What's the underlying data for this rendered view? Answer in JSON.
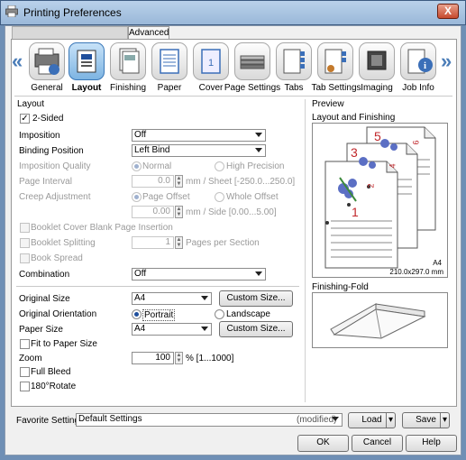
{
  "window": {
    "title": "Printing Preferences",
    "close_label": "X"
  },
  "tabs": {
    "advanced_label": "Advanced"
  },
  "nav": {
    "left_arrow": "«",
    "right_arrow": "»",
    "items": [
      {
        "label": "General",
        "icon": "general-icon"
      },
      {
        "label": "Layout",
        "icon": "layout-icon",
        "active": true
      },
      {
        "label": "Finishing",
        "icon": "finishing-icon"
      },
      {
        "label": "Paper",
        "icon": "paper-icon"
      },
      {
        "label": "Cover",
        "icon": "cover-icon"
      },
      {
        "label": "Page Settings",
        "icon": "page-settings-icon"
      },
      {
        "label": "Tabs",
        "icon": "tabs-icon"
      },
      {
        "label": "Tab Settings",
        "icon": "tab-settings-icon"
      },
      {
        "label": "Imaging",
        "icon": "imaging-icon"
      },
      {
        "label": "Job Info",
        "icon": "job-info-icon"
      }
    ]
  },
  "layout": {
    "section_label": "Layout",
    "two_sided": {
      "label": "2-Sided",
      "checked": true,
      "mark": "✓"
    },
    "imposition": {
      "label": "Imposition",
      "value": "Off"
    },
    "binding_position": {
      "label": "Binding Position",
      "value": "Left Bind"
    },
    "imposition_quality": {
      "label": "Imposition Quality",
      "normal": "Normal",
      "high": "High Precision"
    },
    "page_interval": {
      "label": "Page Interval",
      "value": "0.0",
      "unit": "mm / Sheet [-250.0...250.0]"
    },
    "creep_adjustment": {
      "label": "Creep Adjustment",
      "page_offset": "Page Offset",
      "whole_offset": "Whole Offset",
      "value": "0.00",
      "unit": "mm / Side [0.00...5.00]"
    },
    "booklet_blank": {
      "label": "Booklet Cover Blank Page Insertion"
    },
    "booklet_splitting": {
      "label": "Booklet Splitting",
      "value": "1",
      "unit": "Pages per Section"
    },
    "book_spread": {
      "label": "Book Spread"
    },
    "combination": {
      "label": "Combination",
      "value": "Off"
    },
    "original_size": {
      "label": "Original Size",
      "value": "A4",
      "button": "Custom Size..."
    },
    "original_orientation": {
      "label": "Original Orientation",
      "portrait": "Portrait",
      "landscape": "Landscape"
    },
    "paper_size": {
      "label": "Paper Size",
      "value": "A4",
      "button": "Custom Size..."
    },
    "fit_to_paper": {
      "label": "Fit to Paper Size"
    },
    "zoom": {
      "label": "Zoom",
      "value": "100",
      "unit": "% [1...1000]"
    },
    "full_bleed": {
      "label": "Full Bleed"
    },
    "rotate": {
      "label": "180°Rotate"
    }
  },
  "preview": {
    "section_label": "Preview",
    "layout_finishing_label": "Layout and Finishing",
    "page_numbers": [
      "1",
      "2",
      "3",
      "4",
      "5",
      "6"
    ],
    "paper_name": "A4",
    "paper_dims": "210.0x297.0 mm",
    "finishing_fold_label": "Finishing-Fold"
  },
  "favorite": {
    "label": "Favorite Setting",
    "value": "Default Settings",
    "modified": "(modified)",
    "load": "Load",
    "save": "Save"
  },
  "footer": {
    "ok": "OK",
    "cancel": "Cancel",
    "help": "Help"
  },
  "colors": {
    "accent": "#3a78b8",
    "page_number_red": "#c0262a",
    "flower_blue": "#5b6fc4"
  }
}
